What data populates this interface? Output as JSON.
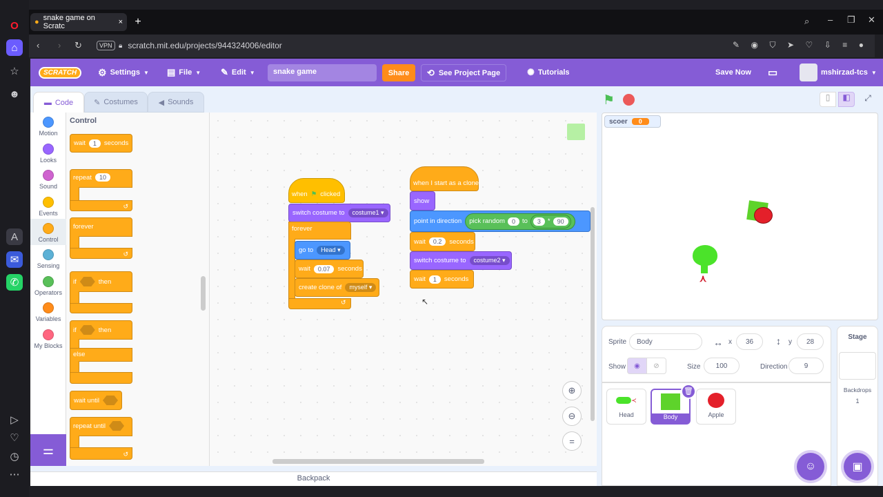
{
  "browser": {
    "tab_title": "snake game on Scratc",
    "vpn_label": "VPN",
    "url": "scratch.mit.edu/projects/944324006/editor"
  },
  "menubar": {
    "logo": "SCRATCH",
    "settings": "Settings",
    "file": "File",
    "edit": "Edit",
    "project_title": "snake game",
    "share": "Share",
    "see_project": "See Project Page",
    "tutorials": "Tutorials",
    "save_now": "Save Now",
    "username": "mshirzad-tcs"
  },
  "editor_tabs": {
    "code": "Code",
    "costumes": "Costumes",
    "sounds": "Sounds"
  },
  "categories": [
    {
      "label": "Motion",
      "color": "#4c97ff"
    },
    {
      "label": "Looks",
      "color": "#9966ff"
    },
    {
      "label": "Sound",
      "color": "#cf63cf"
    },
    {
      "label": "Events",
      "color": "#ffbf00"
    },
    {
      "label": "Control",
      "color": "#ffab19"
    },
    {
      "label": "Sensing",
      "color": "#5cb1d6"
    },
    {
      "label": "Operators",
      "color": "#59c059"
    },
    {
      "label": "Variables",
      "color": "#ff8c1a"
    },
    {
      "label": "My Blocks",
      "color": "#ff6680"
    }
  ],
  "palette": {
    "heading": "Control",
    "wait": "wait",
    "wait_val": "1",
    "seconds": "seconds",
    "repeat": "repeat",
    "repeat_val": "10",
    "forever": "forever",
    "if": "if",
    "then": "then",
    "else": "else",
    "wait_until": "wait until",
    "repeat_until": "repeat until"
  },
  "script1": {
    "when": "when",
    "clicked": "clicked",
    "switch_costume": "switch costume to",
    "costume": "costume1",
    "forever": "forever",
    "go_to": "go to",
    "go_target": "Head",
    "wait": "wait",
    "wait_val": "0.07",
    "seconds": "seconds",
    "create_clone": "create clone of",
    "clone_target": "myself"
  },
  "script2": {
    "hat": "when I start as a clone",
    "show": "show",
    "point": "point in direction",
    "pick_random": "pick random",
    "from": "0",
    "to": "to",
    "a": "3",
    "op": "*",
    "b": "90",
    "wait": "wait",
    "wait1": "0.2",
    "seconds": "seconds",
    "switch_costume": "switch costume to",
    "costume": "costume2",
    "wait2": "1"
  },
  "backpack": "Backpack",
  "stage": {
    "monitor_label": "scoer",
    "monitor_value": "0"
  },
  "sprite_info": {
    "sprite_label": "Sprite",
    "sprite_name": "Body",
    "x_label": "x",
    "x": "36",
    "y_label": "y",
    "y": "28",
    "show_label": "Show",
    "size_label": "Size",
    "size": "100",
    "direction_label": "Direction",
    "direction": "9"
  },
  "sprites": [
    {
      "name": "Head"
    },
    {
      "name": "Body"
    },
    {
      "name": "Apple"
    }
  ],
  "stage_panel": {
    "title": "Stage",
    "backdrops_label": "Backdrops",
    "backdrops_count": "1"
  }
}
